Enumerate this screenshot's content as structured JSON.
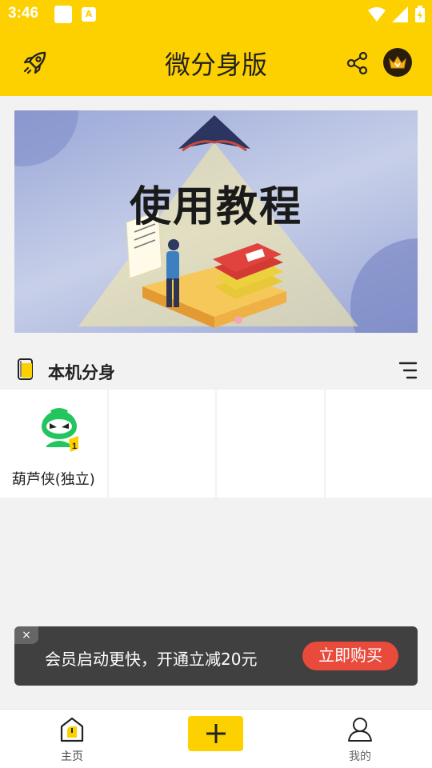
{
  "status_bar": {
    "time": "3:46",
    "a_badge": "A"
  },
  "app_bar": {
    "title": "微分身版",
    "icons": [
      "rocket-icon",
      "share-icon",
      "crown-icon"
    ]
  },
  "banner": {
    "text": "使用教程"
  },
  "section": {
    "title": "本机分身",
    "icons": [
      "phone-icon",
      "sort-icon"
    ]
  },
  "apps": [
    {
      "label": "葫芦侠(独立)",
      "badge": "1"
    }
  ],
  "promo": {
    "close": "×",
    "text": "会员启动更快，开通立减20元",
    "button": "立即购买"
  },
  "tabbar": {
    "home_label": "主页",
    "profile_label": "我的",
    "add_icon": "plus-icon"
  },
  "colors": {
    "brand_yellow": "#fdd000",
    "promo_bg": "#404040",
    "buy_red": "#e84b3c"
  }
}
